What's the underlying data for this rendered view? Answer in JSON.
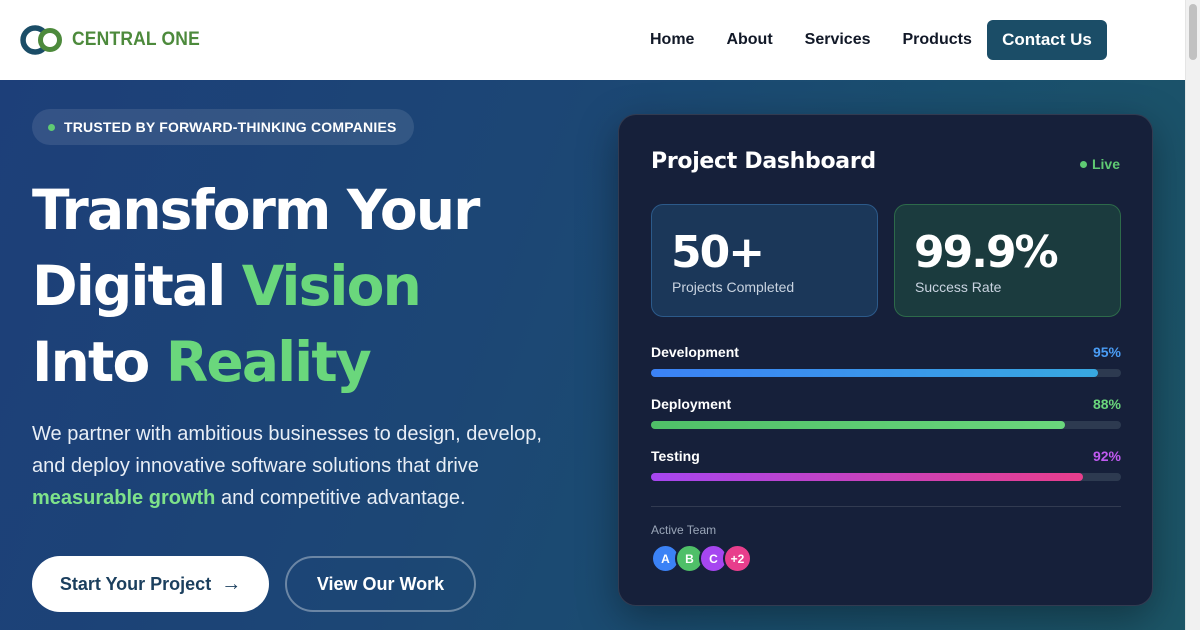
{
  "brand": {
    "name": "CENTRAL ONE",
    "colors": {
      "primary": "#1b4d67",
      "accent": "#6ad77c",
      "logo_green": "#4d8a3c"
    }
  },
  "nav": {
    "items": [
      "Home",
      "About",
      "Services",
      "Products"
    ],
    "contact_label": "Contact Us"
  },
  "hero": {
    "badge": "TRUSTED BY FORWARD-THINKING COMPANIES",
    "headline": {
      "line1": "Transform Your",
      "line2_plain": "Digital ",
      "line2_accent": "Vision",
      "line3_plain": "Into ",
      "line3_accent": "Reality"
    },
    "subtext": {
      "part1": "We partner with ambitious businesses to design, develop, and deploy innovative software solutions that drive ",
      "strong": "measurable growth",
      "part2": " and competitive advantage."
    },
    "primary_button": "Start Your Project",
    "primary_button_icon": "arrow-right-icon",
    "secondary_button": "View Our Work"
  },
  "dashboard": {
    "title": "Project Dashboard",
    "status": "Live",
    "stats": [
      {
        "value": "50+",
        "label": "Projects Completed"
      },
      {
        "value": "99.9%",
        "label": "Success Rate"
      }
    ],
    "progress": [
      {
        "label": "Development",
        "value_text": "95%",
        "value": 95,
        "color": "#4a9df5"
      },
      {
        "label": "Deployment",
        "value_text": "88%",
        "value": 88,
        "color": "#6ad77c"
      },
      {
        "label": "Testing",
        "value_text": "92%",
        "value": 92,
        "color": "#c05af0"
      }
    ],
    "team_label": "Active Team",
    "team": [
      {
        "initial": "A",
        "color": "#3b82f6"
      },
      {
        "initial": "B",
        "color": "#4fbf68"
      },
      {
        "initial": "C",
        "color": "#a646f0"
      },
      {
        "initial": "+2",
        "color": "#e83e8c"
      }
    ]
  }
}
